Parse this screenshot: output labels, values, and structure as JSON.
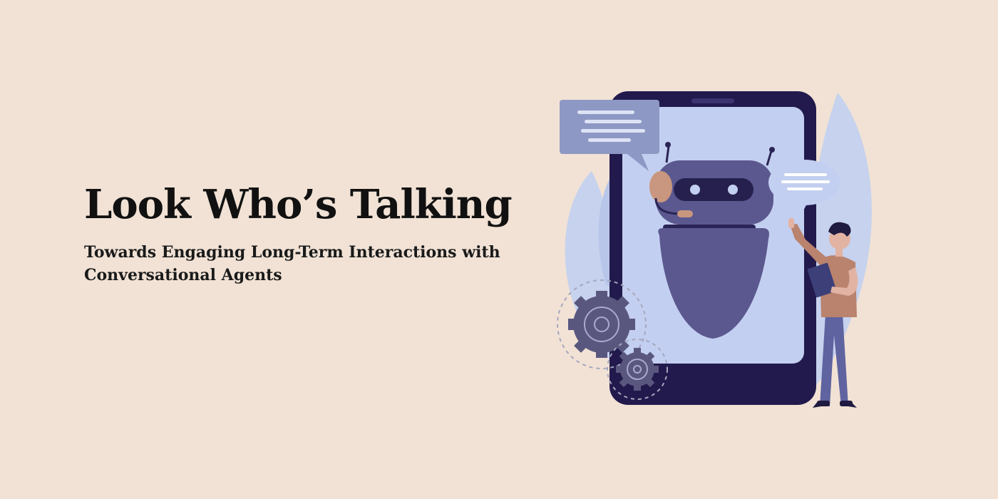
{
  "page": {
    "background_color": "#f1e2d5"
  },
  "hero": {
    "title": "Look Who’s Talking",
    "subtitle_line1": "Towards Engaging Long-Term Interactions with",
    "subtitle_line2": "Conversational Agents"
  },
  "illustration": {
    "icons": [
      "smartphone-icon",
      "robot-icon",
      "chat-bubble-icon",
      "gear-icon",
      "person-icon",
      "leaf-icon"
    ],
    "colors": {
      "phone_frame": "#221a4d",
      "phone_screen": "#c3cff0",
      "robot": "#5b588f",
      "bubble": "#8e98c4",
      "leaf": "#c6d2ee",
      "person_shirt": "#b9836e",
      "person_pants": "#5f63a0"
    }
  }
}
